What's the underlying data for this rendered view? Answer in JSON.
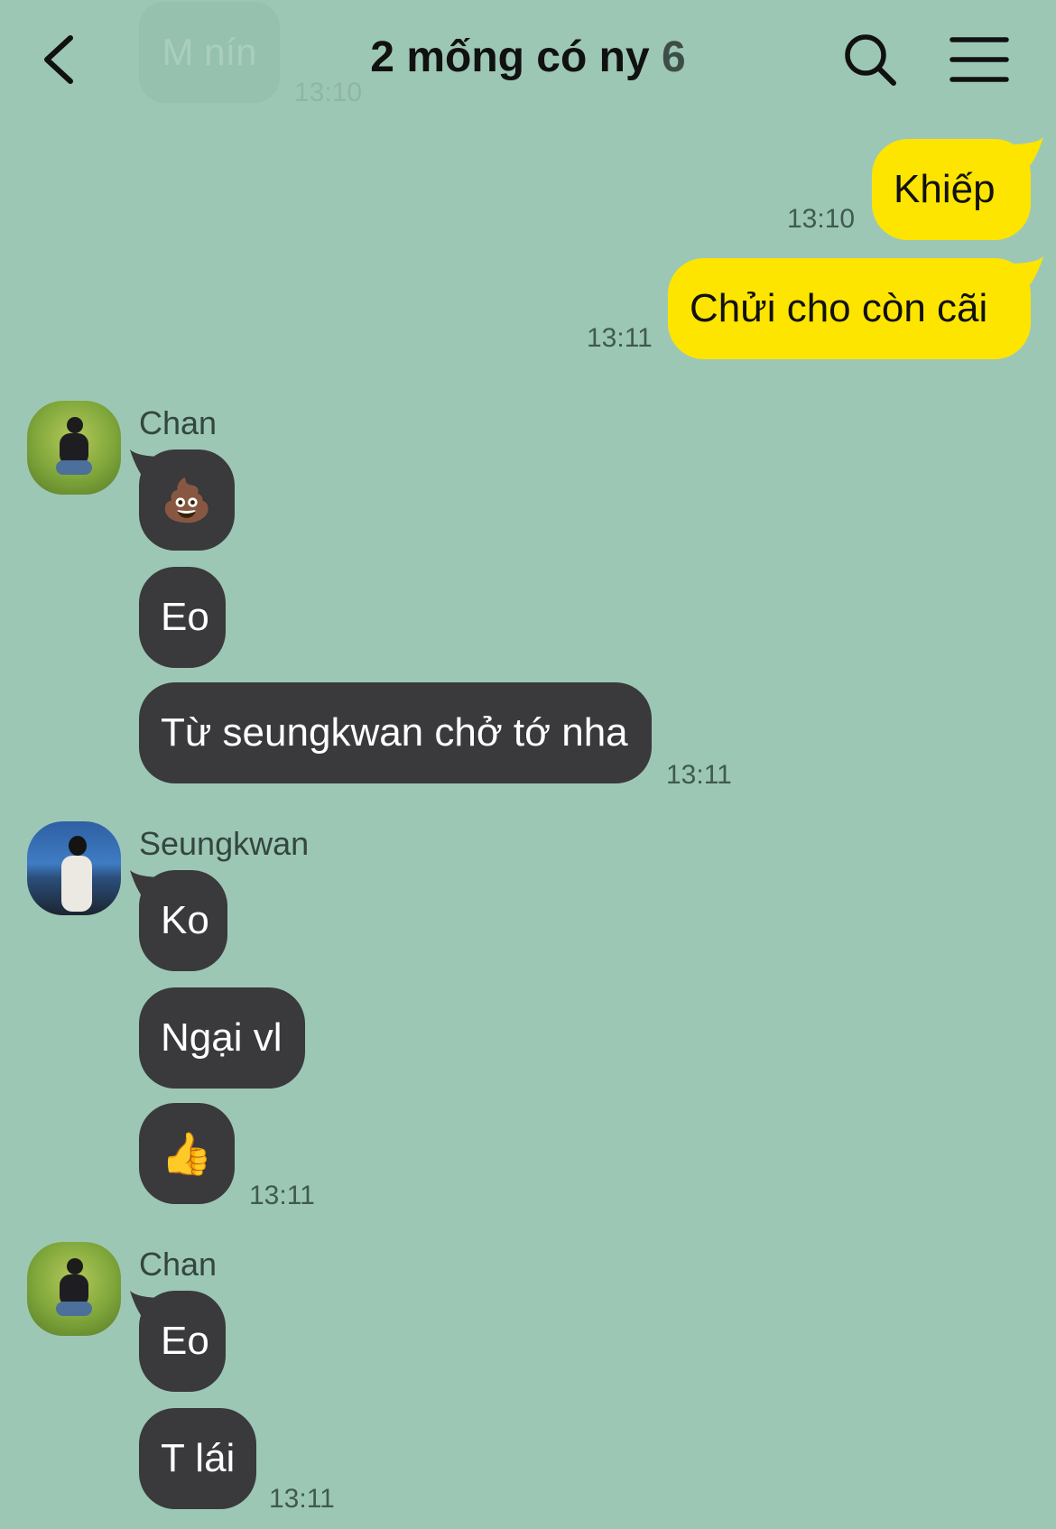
{
  "header": {
    "title": "2 mống có ny",
    "member_count": "6",
    "back_icon": "chevron-left-icon",
    "search_icon": "search-icon",
    "menu_icon": "hamburger-menu-icon"
  },
  "faded_top": {
    "text": "M nín",
    "time": "13:10"
  },
  "colors": {
    "background": "#9dc7b5",
    "incoming_bubble": "#3a393c",
    "outgoing_bubble": "#fde500"
  },
  "messages": {
    "out1": {
      "text": "Khiếp",
      "time": "13:10"
    },
    "out2": {
      "text": "Chửi cho còn cãi",
      "time": "13:11"
    },
    "group1": {
      "sender": "Chan",
      "m1": "💩",
      "m2": "Eo",
      "m3": "Từ seungkwan chở tớ nha",
      "time": "13:11"
    },
    "group2": {
      "sender": "Seungkwan",
      "m1": "Ko",
      "m2": "Ngại vl",
      "m3": "👍",
      "time": "13:11"
    },
    "group3": {
      "sender": "Chan",
      "m1": "Eo",
      "m2": "T lái",
      "time": "13:11"
    }
  }
}
